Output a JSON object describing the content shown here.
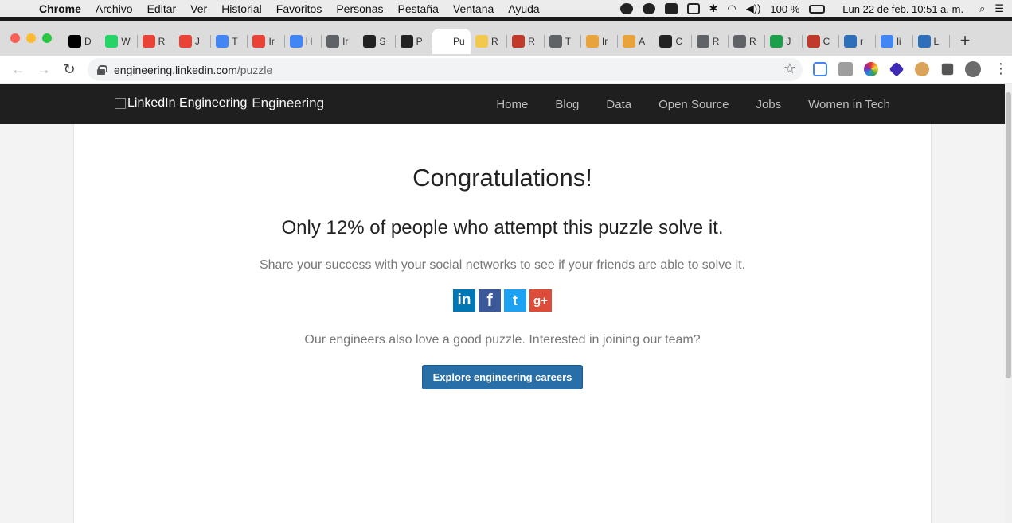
{
  "menubar": {
    "app": "Chrome",
    "items": [
      "Archivo",
      "Editar",
      "Ver",
      "Historial",
      "Favoritos",
      "Personas",
      "Pestaña",
      "Ventana",
      "Ayuda"
    ],
    "battery": "100 %",
    "datetime": "Lun 22 de feb.  10:51 a. m."
  },
  "tabs": [
    {
      "letter": "D",
      "color": "#000000",
      "icon": "medium-icon"
    },
    {
      "letter": "W",
      "color": "#25d366",
      "icon": "whatsapp-icon"
    },
    {
      "letter": "R",
      "color": "#ea4335",
      "icon": "gmail-icon"
    },
    {
      "letter": "J",
      "color": "#ea4335",
      "icon": "gmail-icon"
    },
    {
      "letter": "T",
      "color": "#4285f4",
      "icon": "calendar-icon"
    },
    {
      "letter": "Ir",
      "color": "#ea4335",
      "icon": "gmail-icon"
    },
    {
      "letter": "H",
      "color": "#4285f4",
      "icon": "calendar-icon"
    },
    {
      "letter": "Ir",
      "color": "#5f6368",
      "icon": "globe-icon"
    },
    {
      "letter": "S",
      "color": "#222222",
      "icon": "github-icon"
    },
    {
      "letter": "P",
      "color": "#222222",
      "icon": "github-icon"
    },
    {
      "letter": "Pu",
      "color": "#ffffff",
      "icon": "blank-icon",
      "active": true
    },
    {
      "letter": "R",
      "color": "#f2c94c",
      "icon": "r-icon"
    },
    {
      "letter": "R",
      "color": "#c0392b",
      "icon": "slides-icon"
    },
    {
      "letter": "T",
      "color": "#5f6368",
      "icon": "globe-icon"
    },
    {
      "letter": "Ir",
      "color": "#e8a33d",
      "icon": "ext-icon"
    },
    {
      "letter": "A",
      "color": "#e8a33d",
      "icon": "ext-icon"
    },
    {
      "letter": "C",
      "color": "#222222",
      "icon": "github-icon"
    },
    {
      "letter": "R",
      "color": "#5f6368",
      "icon": "globe-icon"
    },
    {
      "letter": "R",
      "color": "#5f6368",
      "icon": "globe-icon"
    },
    {
      "letter": "J",
      "color": "#1a9f4a",
      "icon": "w-icon"
    },
    {
      "letter": "C",
      "color": "#c0392b",
      "icon": "figure-icon"
    },
    {
      "letter": "r",
      "color": "#2e6fba",
      "icon": "r-square-icon"
    },
    {
      "letter": "li",
      "color": "#4285f4",
      "icon": "google-icon"
    },
    {
      "letter": "L",
      "color": "#2e6fba",
      "icon": "bird-icon"
    }
  ],
  "address": {
    "domain": "engineering.linkedin.com",
    "path": "/puzzle"
  },
  "site": {
    "logo_alt": "LinkedIn Engineering",
    "logo_suffix": "Engineering",
    "nav": [
      "Home",
      "Blog",
      "Data",
      "Open Source",
      "Jobs",
      "Women in Tech"
    ]
  },
  "main": {
    "title": "Congratulations!",
    "subtitle": "Only 12% of people who attempt this puzzle solve it.",
    "share_text": "Share your success with your social networks to see if your friends are able to solve it.",
    "social": [
      {
        "label": "in",
        "name": "linkedin"
      },
      {
        "label": "f",
        "name": "facebook"
      },
      {
        "label": "t",
        "name": "twitter"
      },
      {
        "label": "g+",
        "name": "google-plus"
      }
    ],
    "team_text": "Our engineers also love a good puzzle. Interested in joining our team?",
    "button": "Explore engineering careers"
  }
}
